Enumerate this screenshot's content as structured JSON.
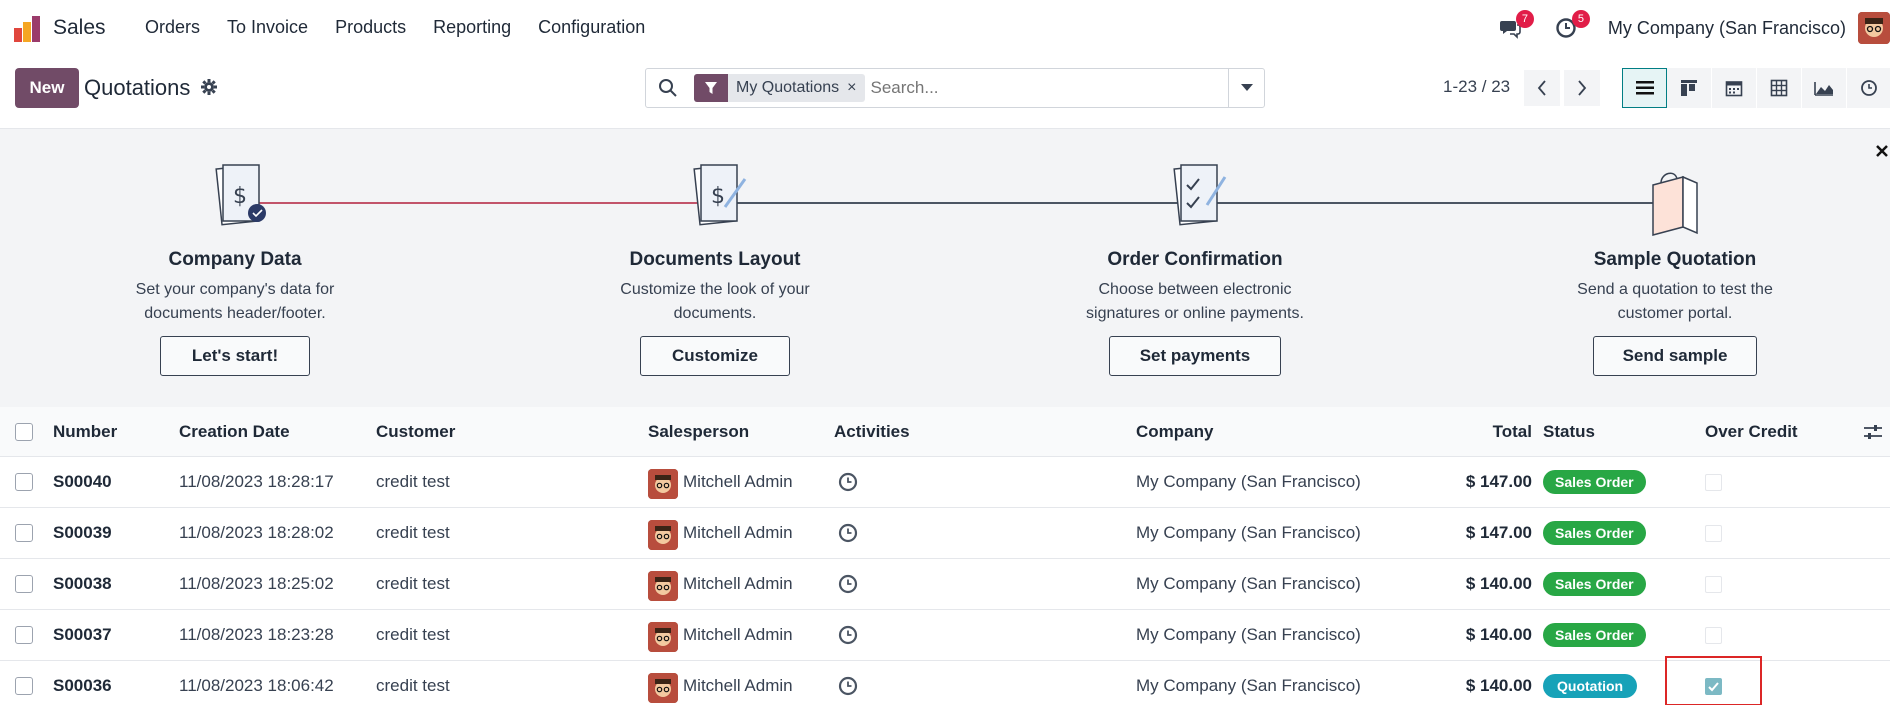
{
  "app": {
    "name": "Sales"
  },
  "menu": [
    "Orders",
    "To Invoice",
    "Products",
    "Reporting",
    "Configuration"
  ],
  "nav": {
    "messages_badge": "7",
    "activities_badge": "5",
    "company": "My Company (San Francisco)"
  },
  "control": {
    "new_label": "New",
    "title": "Quotations",
    "facet_label": "My Quotations",
    "facet_remove": "×",
    "search_placeholder": "Search...",
    "pager": "1-23 / 23"
  },
  "onboarding": {
    "steps": [
      {
        "title": "Company Data",
        "desc": "Set your company's data for documents header/footer.",
        "button": "Let's start!"
      },
      {
        "title": "Documents Layout",
        "desc": "Customize the look of your documents.",
        "button": "Customize"
      },
      {
        "title": "Order Confirmation",
        "desc": "Choose between electronic signatures or online payments.",
        "button": "Set payments"
      },
      {
        "title": "Sample Quotation",
        "desc": "Send a quotation to test the customer portal.",
        "button": "Send sample"
      }
    ]
  },
  "table": {
    "headers": {
      "number": "Number",
      "creation_date": "Creation Date",
      "customer": "Customer",
      "salesperson": "Salesperson",
      "activities": "Activities",
      "company": "Company",
      "total": "Total",
      "status": "Status",
      "over_credit": "Over Credit"
    },
    "rows": [
      {
        "number": "S00040",
        "date": "11/08/2023 18:28:17",
        "customer": "credit test",
        "salesperson": "Mitchell Admin",
        "company": "My Company (San Francisco)",
        "total": "$ 147.00",
        "status": "Sales Order",
        "over_credit": false
      },
      {
        "number": "S00039",
        "date": "11/08/2023 18:28:02",
        "customer": "credit test",
        "salesperson": "Mitchell Admin",
        "company": "My Company (San Francisco)",
        "total": "$ 147.00",
        "status": "Sales Order",
        "over_credit": false
      },
      {
        "number": "S00038",
        "date": "11/08/2023 18:25:02",
        "customer": "credit test",
        "salesperson": "Mitchell Admin",
        "company": "My Company (San Francisco)",
        "total": "$ 140.00",
        "status": "Sales Order",
        "over_credit": false
      },
      {
        "number": "S00037",
        "date": "11/08/2023 18:23:28",
        "customer": "credit test",
        "salesperson": "Mitchell Admin",
        "company": "My Company (San Francisco)",
        "total": "$ 140.00",
        "status": "Sales Order",
        "over_credit": false
      },
      {
        "number": "S00036",
        "date": "11/08/2023 18:06:42",
        "customer": "credit test",
        "salesperson": "Mitchell Admin",
        "company": "My Company (San Francisco)",
        "total": "$ 140.00",
        "status": "Quotation",
        "over_credit": true
      }
    ]
  },
  "colors": {
    "brand": "#714b67",
    "accent": "#017e84",
    "sales_order": "#28a745",
    "quotation": "#17a2b8",
    "highlight": "#dc2626"
  }
}
